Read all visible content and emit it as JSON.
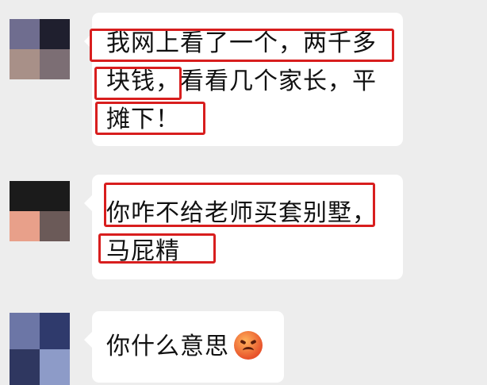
{
  "chat": {
    "messages": [
      {
        "lines": [
          "我网上看了一个，两千多",
          "块钱，看看几个家长，平",
          "摊下！"
        ],
        "avatar_colors": [
          "#6f6d8f",
          "#1f1f2e",
          "#a89088",
          "#7c6e74"
        ]
      },
      {
        "lines": [
          "你咋不给老师买套别墅，",
          "马屁精"
        ],
        "avatar_colors": [
          "#1b1b1b",
          "#1b1b1b",
          "#e8a08a",
          "#6b5a58"
        ]
      },
      {
        "lines": [
          "你什么意思"
        ],
        "emoji": "angry-face-icon",
        "avatar_colors": [
          "#6c76a6",
          "#2f3a6c",
          "#2f3760",
          "#8d9bc8"
        ]
      }
    ]
  },
  "colors": {
    "background": "#ededed",
    "bubble": "#ffffff",
    "highlight": "#d81e1e"
  }
}
